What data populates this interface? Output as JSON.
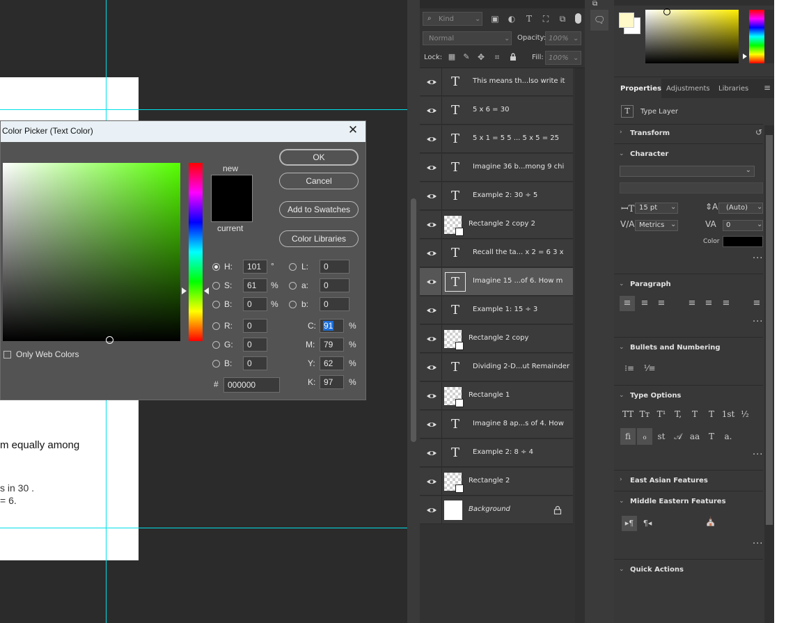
{
  "canvas": {
    "doc_lines": [
      "m equally among",
      "s in 30 .",
      "= 6."
    ]
  },
  "color_picker": {
    "title": "Color Picker (Text Color)",
    "new_label": "new",
    "current_label": "current",
    "buttons": {
      "ok": "OK",
      "cancel": "Cancel",
      "add_swatches": "Add to Swatches",
      "color_libraries": "Color Libraries"
    },
    "only_web_colors": "Only Web Colors",
    "hsb": {
      "h_label": "H:",
      "h": "101",
      "h_unit": "°",
      "s_label": "S:",
      "s": "61",
      "s_unit": "%",
      "b_label": "B:",
      "b": "0",
      "b_unit": "%"
    },
    "lab": {
      "l_label": "L:",
      "l": "0",
      "a_label": "a:",
      "a": "0",
      "b_label": "b:",
      "b": "0"
    },
    "rgb": {
      "r_label": "R:",
      "r": "0",
      "g_label": "G:",
      "g": "0",
      "b_label": "B:",
      "b": "0"
    },
    "cmyk": {
      "c_label": "C:",
      "c": "91",
      "m_label": "M:",
      "m": "79",
      "y_label": "Y:",
      "y": "62",
      "k_label": "K:",
      "k": "97",
      "unit": "%"
    },
    "hex_label": "#",
    "hex": "000000",
    "hue_color": "#55ff00",
    "new_color": "#000000",
    "current_color": "#000000"
  },
  "layers_panel": {
    "filter_kind": "Kind",
    "blend_mode": "Normal",
    "opacity_label": "Opacity:",
    "opacity": "100%",
    "lock_label": "Lock:",
    "fill_label": "Fill:",
    "fill": "100%",
    "layers": [
      {
        "name": "This means th...lso write it",
        "kind": "text"
      },
      {
        "name": "5 x 6 =  30",
        "kind": "text"
      },
      {
        "name": "5 x 1 =  5 5 ... 5 x 5 =  25",
        "kind": "text"
      },
      {
        "name": "Imagine 36 b...mong  9 chi",
        "kind": "text"
      },
      {
        "name": "Example 2: 30 ÷ 5",
        "kind": "text"
      },
      {
        "name": "Rectangle 2 copy 2",
        "kind": "shape"
      },
      {
        "name": "Recall the ta... x 2 =  6 3 x",
        "kind": "text"
      },
      {
        "name": "Imagine 15 ...of 6. How m",
        "kind": "text",
        "selected": true
      },
      {
        "name": "Example 1: 15 ÷ 3",
        "kind": "text"
      },
      {
        "name": "Rectangle 2 copy",
        "kind": "shape"
      },
      {
        "name": "Dividing 2-D...ut Remainder",
        "kind": "text"
      },
      {
        "name": "Rectangle 1",
        "kind": "shape"
      },
      {
        "name": "Imagine 8 ap...s of 4. How",
        "kind": "text"
      },
      {
        "name": "Example 2: 8 ÷ 4",
        "kind": "text"
      },
      {
        "name": "Rectangle 2",
        "kind": "shape"
      },
      {
        "name": "Background",
        "kind": "background"
      }
    ]
  },
  "properties": {
    "tabs": [
      "Properties",
      "Adjustments",
      "Libraries"
    ],
    "layer_type": "Type Layer",
    "sections": {
      "transform": "Transform",
      "character": "Character",
      "paragraph": "Paragraph",
      "bullets": "Bullets and Numbering",
      "type_options": "Type Options",
      "east_asian": "East Asian Features",
      "middle_eastern": "Middle Eastern Features",
      "quick_actions": "Quick Actions"
    },
    "character": {
      "font_size": "15 pt",
      "leading": "(Auto)",
      "kerning": "Metrics",
      "tracking": "0",
      "color_label": "Color",
      "color": "#000000"
    },
    "type_options_glyphs": [
      "TT",
      "Tт",
      "T¹",
      "T,",
      "T",
      "T",
      "1st",
      "½"
    ],
    "type_options_glyphs2": [
      "fi",
      "ℴ",
      "st",
      "𝒜",
      "aa",
      "T",
      "a."
    ]
  },
  "foreground_color": "#fff8c8",
  "background_color": "#ffffff",
  "gradient_hue": "#ffee00"
}
